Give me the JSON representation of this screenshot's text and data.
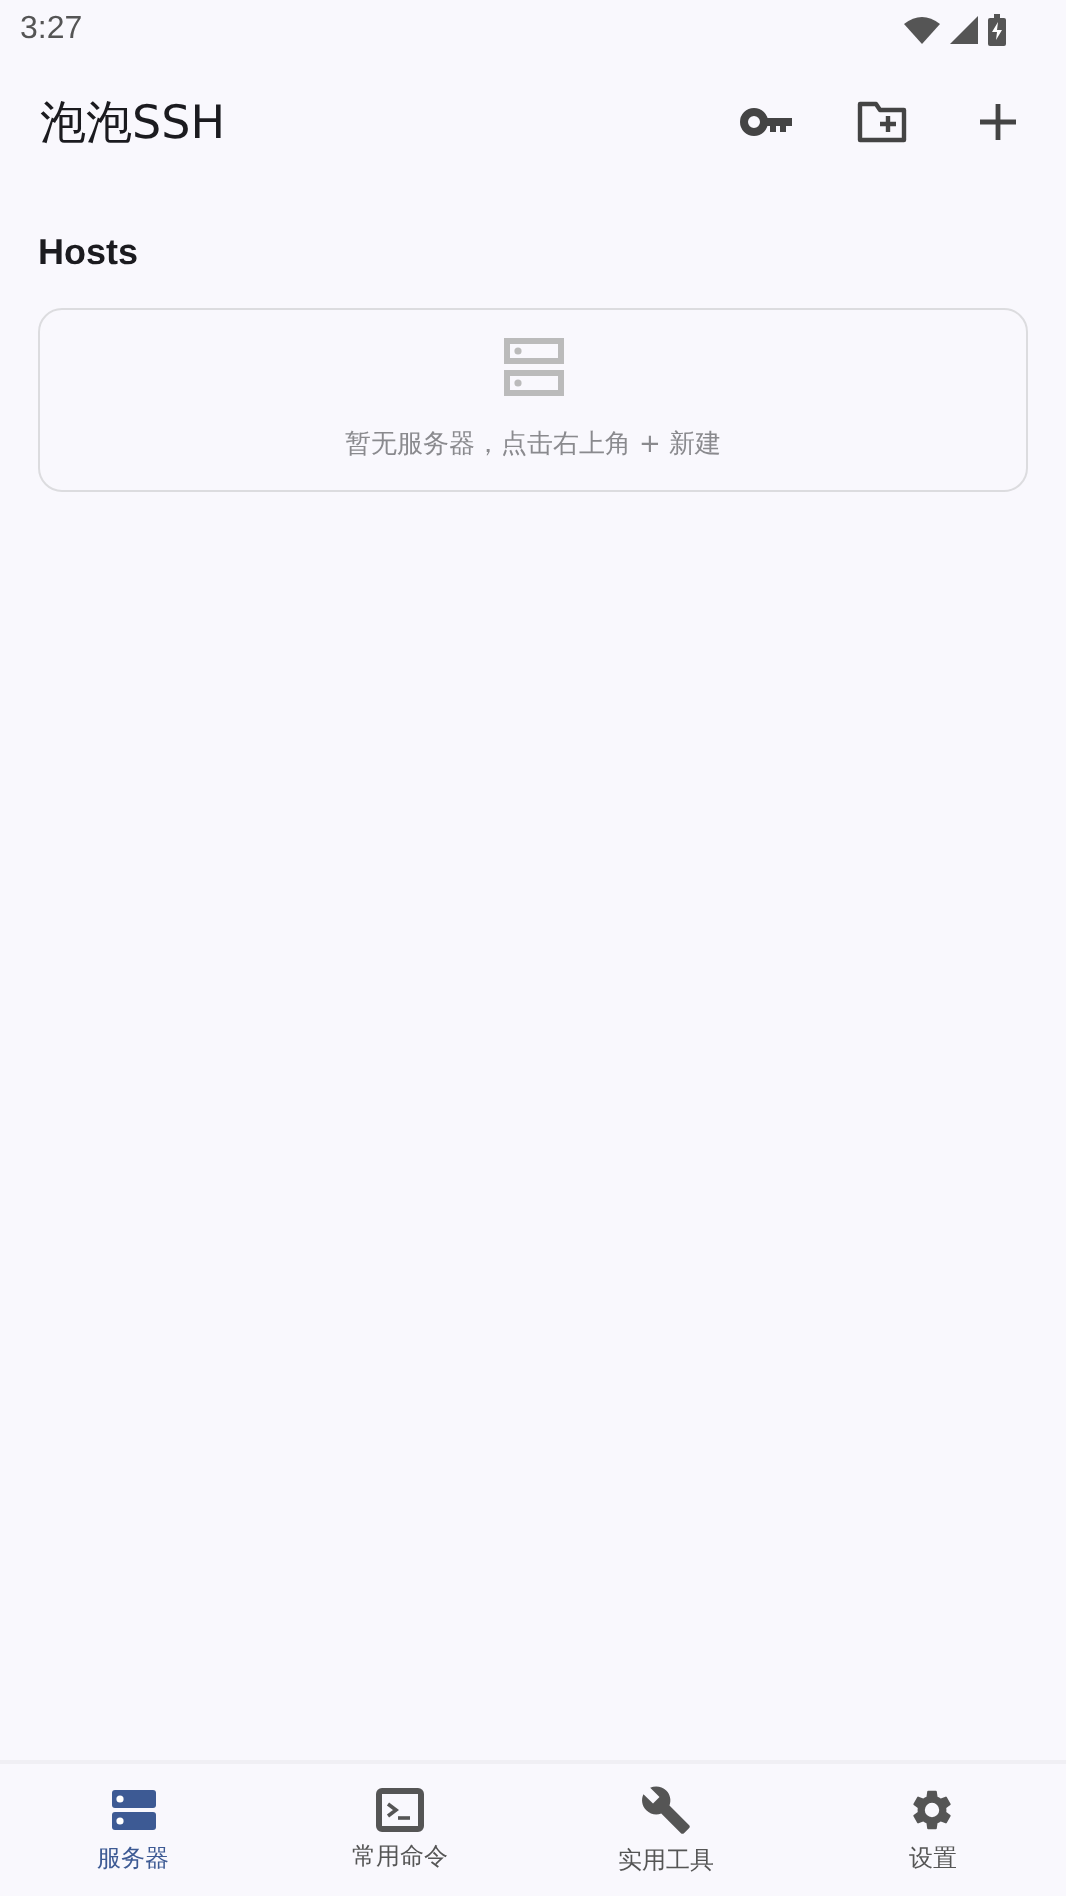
{
  "status_bar": {
    "time": "3:27"
  },
  "app_bar": {
    "title": "泡泡SSH"
  },
  "section": {
    "title": "Hosts"
  },
  "empty_state": {
    "message": "暂无服务器，点击右上角 + 新建"
  },
  "bottom_nav": [
    {
      "label": "服务器",
      "kind": "servers",
      "selected": true
    },
    {
      "label": "常用命令",
      "kind": "terminal",
      "selected": false
    },
    {
      "label": "实用工具",
      "kind": "tools",
      "selected": false
    },
    {
      "label": "设置",
      "kind": "settings",
      "selected": false
    }
  ]
}
